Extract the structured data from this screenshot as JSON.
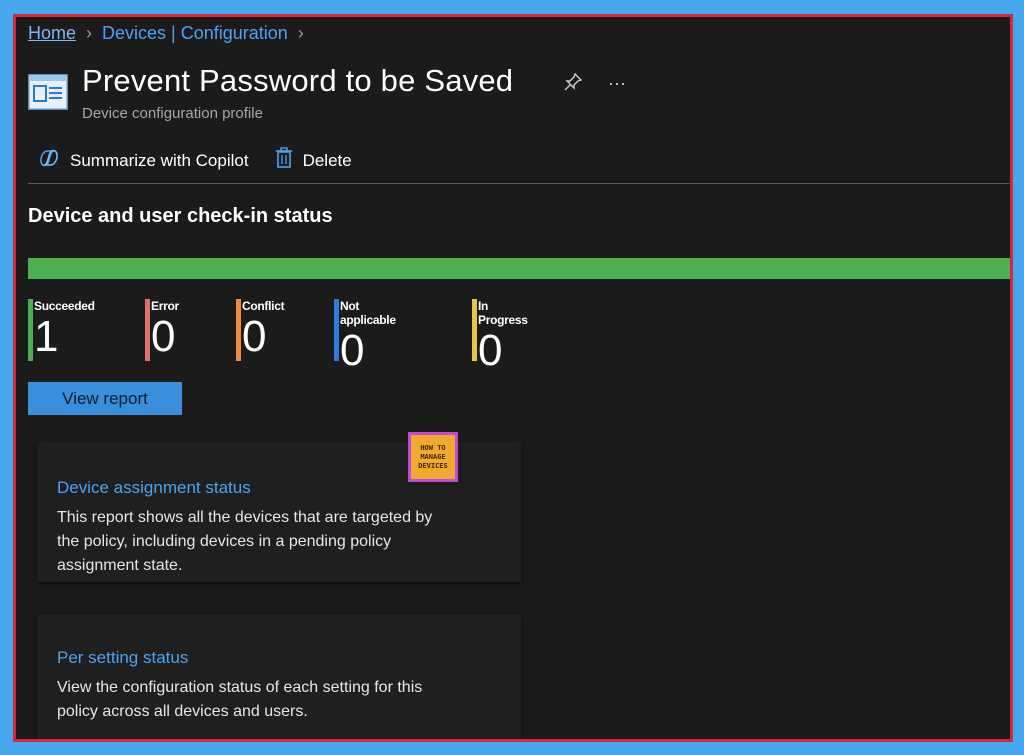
{
  "breadcrumb": {
    "home": "Home",
    "section": "Devices | Configuration"
  },
  "header": {
    "title": "Prevent Password to be Saved",
    "subtitle": "Device configuration profile",
    "pin_icon": "pin-icon",
    "more": "···"
  },
  "toolbar": {
    "copilot_label": "Summarize with Copilot",
    "delete_label": "Delete"
  },
  "status": {
    "section_title": "Device and user check-in status",
    "progress_fraction": 1.0,
    "items": [
      {
        "label": "Succeeded",
        "value": "1",
        "color": "#4caf50"
      },
      {
        "label": "Error",
        "value": "0",
        "color": "#e0706a"
      },
      {
        "label": "Conflict",
        "value": "0",
        "color": "#f08a3c"
      },
      {
        "label": "Not applicable",
        "value": "0",
        "color": "#2a7ce0"
      },
      {
        "label": "In Progress",
        "value": "0",
        "color": "#e8c547"
      }
    ],
    "view_report": "View report"
  },
  "cards": [
    {
      "title": "Device assignment status",
      "description": "This report shows all the devices that are targeted by the policy, including devices in a pending policy assignment state."
    },
    {
      "title": "Per setting status",
      "description": "View the configuration status of each setting for this policy across all devices and users."
    }
  ],
  "watermark": {
    "line1": "HOW TO",
    "line2": "MANAGE",
    "line3": "DEVICES"
  },
  "colors": {
    "accent": "#4aa3f0",
    "progress": "#4caf50",
    "frame": "#d7263d",
    "background": "#1b1b1b"
  }
}
